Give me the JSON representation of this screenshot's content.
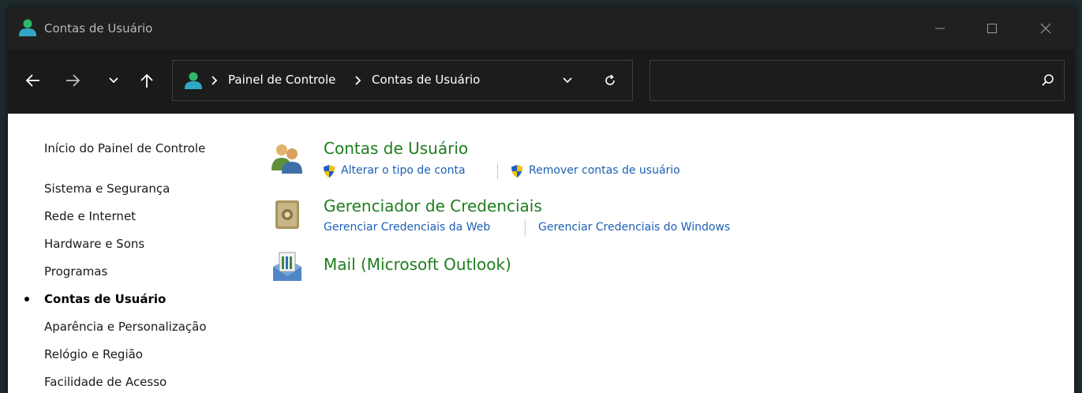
{
  "window": {
    "title": "Contas de Usuário"
  },
  "address": {
    "crumbs": [
      "Painel de Controle",
      "Contas de Usuário"
    ]
  },
  "search": {
    "value": "",
    "placeholder": ""
  },
  "sidebar": {
    "home": "Início do Painel de Controle",
    "items": [
      {
        "label": "Sistema e Segurança",
        "active": false
      },
      {
        "label": "Rede e Internet",
        "active": false
      },
      {
        "label": "Hardware e Sons",
        "active": false
      },
      {
        "label": "Programas",
        "active": false
      },
      {
        "label": "Contas de Usuário",
        "active": true
      },
      {
        "label": "Aparência e Personalização",
        "active": false
      },
      {
        "label": "Relógio e Região",
        "active": false
      },
      {
        "label": "Facilidade de Acesso",
        "active": false
      }
    ]
  },
  "categories": [
    {
      "title": "Contas de Usuário",
      "icon": "users-icon",
      "links": [
        "Alterar o tipo de conta",
        "Remover contas de usuário"
      ]
    },
    {
      "title": "Gerenciador de Credenciais",
      "icon": "safe-vault-icon",
      "links": [
        "Gerenciar Credenciais da Web",
        "Gerenciar Credenciais do Windows"
      ]
    },
    {
      "title": "Mail (Microsoft Outlook)",
      "icon": "mail-icon",
      "links": []
    }
  ],
  "colors": {
    "category_title": "#1e7d1e",
    "link": "#1c5fb4",
    "titlebar": "#202020",
    "navbar": "#1a1a1a"
  }
}
